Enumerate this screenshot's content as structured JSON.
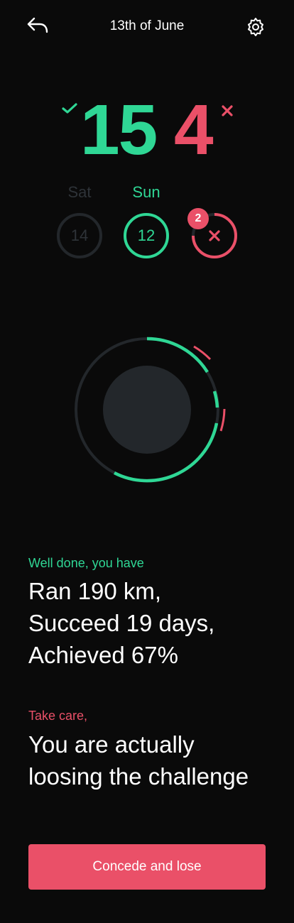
{
  "header": {
    "title": "13th of June",
    "back_icon": "undo-arrow-icon",
    "settings_icon": "gear-icon"
  },
  "score": {
    "won": "15",
    "lost": "4"
  },
  "days": [
    {
      "label": "Sat",
      "value": "14",
      "state": "inactive"
    },
    {
      "label": "Sun",
      "value": "12",
      "state": "active"
    },
    {
      "label": "",
      "value": "",
      "state": "failed",
      "badge": "2"
    }
  ],
  "messages": {
    "success_label": "Well done, you have",
    "success_lines": [
      "Ran 190 km,",
      "Succeed 19 days,",
      "Achieved 67%"
    ],
    "warning_label": "Take care,",
    "warning_lines": [
      "You are actually",
      "loosing the challenge"
    ]
  },
  "actions": {
    "concede_label": "Concede and lose"
  },
  "colors": {
    "accent_green": "#2fd795",
    "accent_red": "#ea5068",
    "ring_gray": "#23272b",
    "background": "#0a0a0a"
  }
}
